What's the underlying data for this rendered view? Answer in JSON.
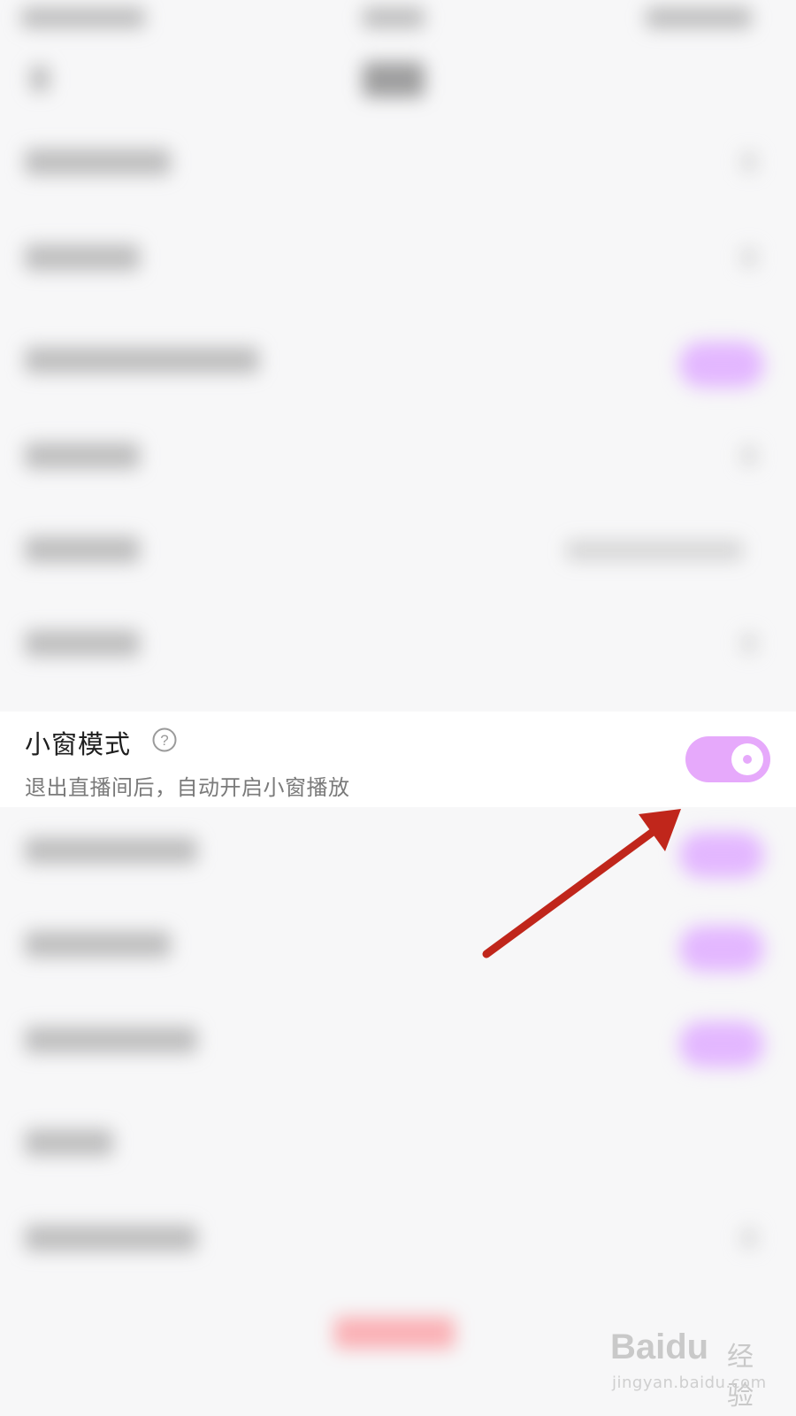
{
  "accent": "#e6a9fb",
  "arrow_color": "#c0261b",
  "setting": {
    "title": "小窗模式",
    "subtitle": "退出直播间后，自动开启小窗播放",
    "help_icon": "question-circle-icon",
    "toggle_state": "on"
  },
  "watermark": {
    "brand": "Baidu",
    "jingyan": "经验",
    "url": "jingyan.baidu.com"
  }
}
